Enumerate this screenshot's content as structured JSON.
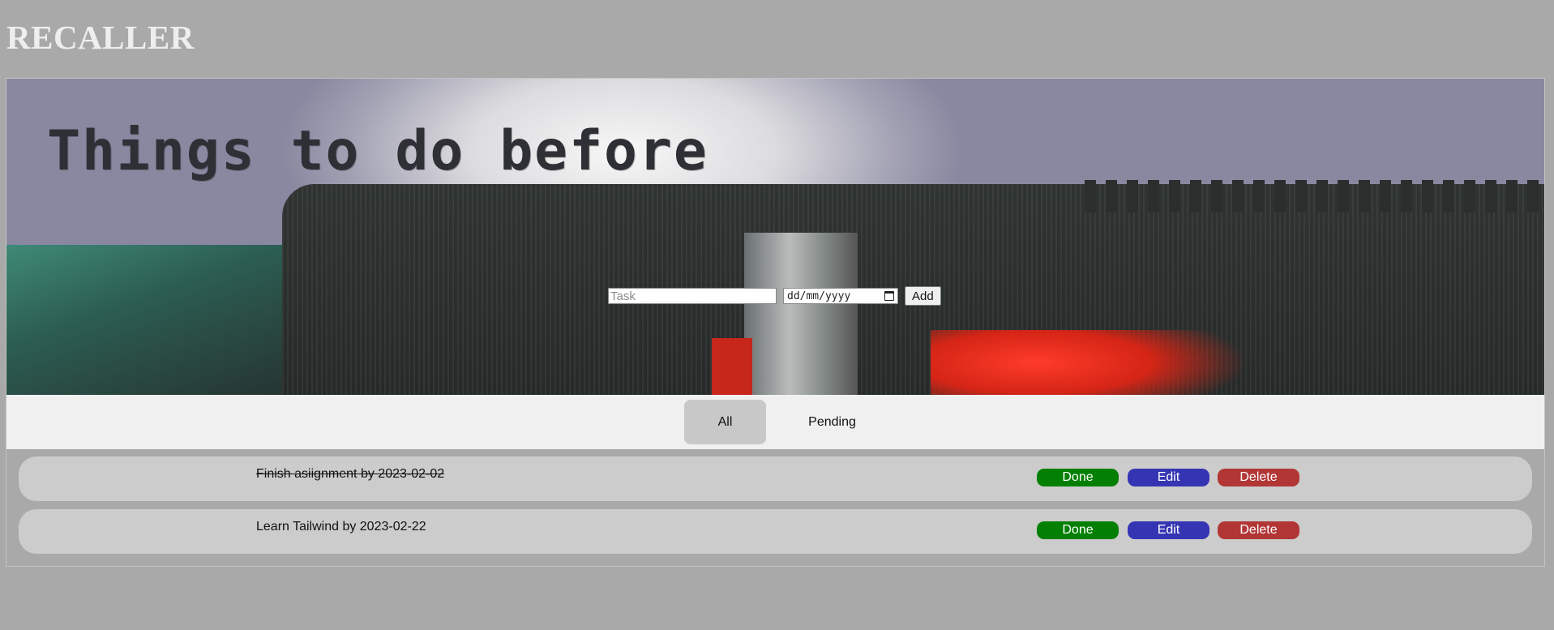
{
  "app": {
    "title": "RECALLER"
  },
  "hero": {
    "typed_text": "Things to do before"
  },
  "form": {
    "task_placeholder": "Task",
    "task_value": "",
    "date_placeholder": "dd/mm/yyyy",
    "add_label": "Add"
  },
  "filters": [
    {
      "label": "All",
      "active": true
    },
    {
      "label": "Pending",
      "active": false
    }
  ],
  "tasks": [
    {
      "text": "Finish  asiignment by 2023-02-02",
      "completed": true
    },
    {
      "text": "Learn Tailwind by 2023-02-22",
      "completed": false
    }
  ],
  "actions": {
    "done_label": "Done",
    "edit_label": "Edit",
    "delete_label": "Delete"
  },
  "colors": {
    "background": "#a9a9a9",
    "done": "#038003",
    "edit": "#3535b4",
    "delete": "#b23636",
    "row": "#cccccc",
    "filter_bar": "#f0f0f0"
  }
}
